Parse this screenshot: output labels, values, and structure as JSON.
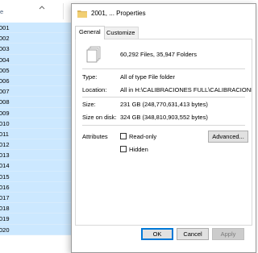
{
  "explorer": {
    "header_name": "e",
    "rows": [
      "001",
      "002",
      "003",
      "004",
      "005",
      "006",
      "007",
      "008",
      "009",
      "010",
      "011",
      "012",
      "013",
      "014",
      "015",
      "016",
      "017",
      "018",
      "019",
      "020"
    ]
  },
  "dialog": {
    "title": "2001, ... Properties",
    "tabs": [
      {
        "label": "General",
        "active": true
      },
      {
        "label": "Customize",
        "active": false
      }
    ],
    "summary": "60,292 Files, 35,947 Folders",
    "fields": {
      "type_label": "Type:",
      "type_value": "All of type File folder",
      "location_label": "Location:",
      "location_value": "All in H:\\CALIBRACIONES FULL\\CALIBRACIONES",
      "size_label": "Size:",
      "size_value": "231 GB (248,770,631,413 bytes)",
      "size_on_disk_label": "Size on disk:",
      "size_on_disk_value": "324 GB (348,810,903,552 bytes)"
    },
    "attributes": {
      "label": "Attributes",
      "readonly_label": "Read-only",
      "readonly_checked": false,
      "hidden_label": "Hidden",
      "hidden_checked": false,
      "advanced_label": "Advanced..."
    },
    "buttons": {
      "ok": "OK",
      "cancel": "Cancel",
      "apply": "Apply"
    }
  },
  "colors": {
    "selection": "#cce8ff",
    "ok_border": "#0078d7",
    "folder": "#dcb45a"
  }
}
